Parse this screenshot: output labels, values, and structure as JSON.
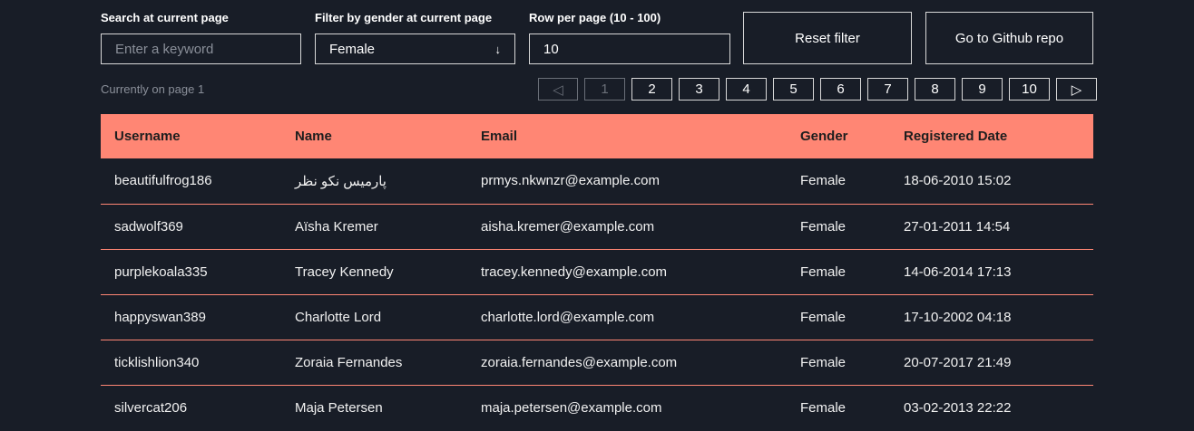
{
  "controls": {
    "search_label": "Search at current page",
    "search_placeholder": "Enter a keyword",
    "search_value": "",
    "gender_label": "Filter by gender at current page",
    "gender_value": "Female",
    "gender_icon": "arrow-down-icon",
    "rows_label": "Row per page (10 - 100)",
    "rows_value": "10",
    "reset_label": "Reset filter",
    "github_label": "Go to Github repo"
  },
  "pagination": {
    "info": "Currently on page 1",
    "prev": "◁",
    "next": "▷",
    "pages": [
      "1",
      "2",
      "3",
      "4",
      "5",
      "6",
      "7",
      "8",
      "9",
      "10"
    ],
    "current": "1"
  },
  "table": {
    "headers": [
      "Username",
      "Name",
      "Email",
      "Gender",
      "Registered Date"
    ],
    "rows": [
      [
        "beautifulfrog186",
        "پارمیس نکو نظر",
        "prmys.nkwnzr@example.com",
        "Female",
        "18-06-2010 15:02"
      ],
      [
        "sadwolf369",
        "Aïsha Kremer",
        "aisha.kremer@example.com",
        "Female",
        "27-01-2011 14:54"
      ],
      [
        "purplekoala335",
        "Tracey Kennedy",
        "tracey.kennedy@example.com",
        "Female",
        "14-06-2014 17:13"
      ],
      [
        "happyswan389",
        "Charlotte Lord",
        "charlotte.lord@example.com",
        "Female",
        "17-10-2002 04:18"
      ],
      [
        "ticklishlion340",
        "Zoraia Fernandes",
        "zoraia.fernandes@example.com",
        "Female",
        "20-07-2017 21:49"
      ],
      [
        "silvercat206",
        "Maja Petersen",
        "maja.petersen@example.com",
        "Female",
        "03-02-2013 22:22"
      ]
    ]
  }
}
